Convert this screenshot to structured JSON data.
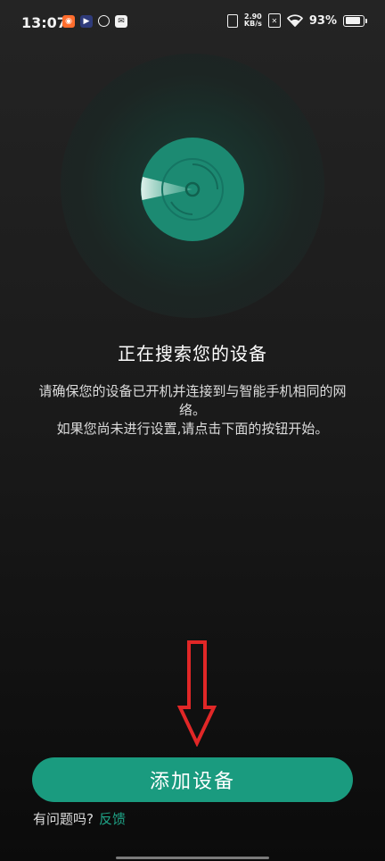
{
  "status_bar": {
    "time": "13:07",
    "left_icons": [
      "notification-app-icon",
      "video-app-icon",
      "sync-app-icon",
      "chat-app-icon"
    ],
    "net_speed_value": "2.90",
    "net_speed_unit": "KB/s",
    "battery_percent": "93%",
    "battery_level": 0.93,
    "sim_label": "✕"
  },
  "search": {
    "title": "正在搜索您的设备",
    "description_line1": "请确保您的设备已开机并连接到与智能手机相同的网络。",
    "description_line2": "如果您尚未进行设置,请点击下面的按钮开始。"
  },
  "actions": {
    "add_device_label": "添加设备",
    "help_text": "有问题吗?",
    "feedback_label": "反馈"
  },
  "colors": {
    "accent": "#1a9b7f",
    "disc": "#1c8a72",
    "annotation": "#e12727"
  }
}
